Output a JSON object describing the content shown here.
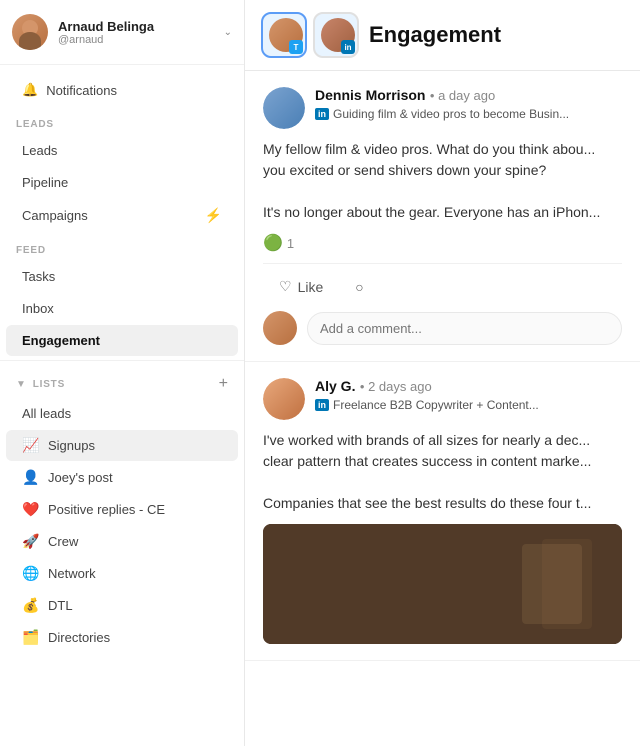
{
  "user": {
    "name": "Arnaud Belinga",
    "handle": "@arnaud"
  },
  "sidebar": {
    "notifications_label": "Notifications",
    "leads_section": "LEADS",
    "feed_section": "FEED",
    "lists_section": "LISTS",
    "nav_items": [
      {
        "id": "leads",
        "label": "Leads"
      },
      {
        "id": "pipeline",
        "label": "Pipeline"
      },
      {
        "id": "campaigns",
        "label": "Campaigns"
      },
      {
        "id": "tasks",
        "label": "Tasks"
      },
      {
        "id": "inbox",
        "label": "Inbox"
      },
      {
        "id": "engagement",
        "label": "Engagement"
      }
    ],
    "all_leads_label": "All leads",
    "lists": [
      {
        "id": "signups",
        "label": "Signups",
        "icon": "📈",
        "active": true
      },
      {
        "id": "joeys-post",
        "label": "Joey's post",
        "icon": "👤",
        "draggable": true
      },
      {
        "id": "positive-replies",
        "label": "Positive replies - CE",
        "icon": "❤️"
      },
      {
        "id": "crew",
        "label": "Crew",
        "icon": "🚀"
      },
      {
        "id": "network",
        "label": "Network",
        "icon": "🌐"
      },
      {
        "id": "dtl",
        "label": "DTL",
        "icon": "💰"
      },
      {
        "id": "directories",
        "label": "Directories",
        "icon": "🗂️"
      }
    ]
  },
  "main": {
    "header_title": "Engagement",
    "profile_buttons": [
      {
        "id": "twitter",
        "social": "T"
      },
      {
        "id": "linkedin",
        "social": "in"
      }
    ]
  },
  "posts": [
    {
      "id": "post1",
      "author": "Dennis Morrison",
      "time": "a day ago",
      "subtitle": "Guiding film & video pros to become Busin...",
      "social": "in",
      "body_line1": "My fellow film & video pros. What do you think abou...",
      "body_line2": "you excited or send shivers down your spine?",
      "body_line3": "It's no longer about the gear. Everyone has an iPhon...",
      "reaction": "🟢",
      "reaction_count": "1",
      "like_label": "Like",
      "comment_placeholder": "Add a comment...",
      "has_image": false
    },
    {
      "id": "post2",
      "author": "Aly G.",
      "time": "2 days ago",
      "subtitle": "Freelance B2B Copywriter + Content...",
      "social": "in",
      "body_line1": "I've worked with brands of all sizes for nearly a dec...",
      "body_line2": "clear pattern that creates success in content marke...",
      "body_line3": "Companies that see the best results do these four t...",
      "has_image": true
    }
  ],
  "icons": {
    "bell": "🔔",
    "chevron_down": "⌄",
    "lightning": "⚡",
    "plus": "+",
    "drag": "⠿",
    "more": "⋮"
  }
}
